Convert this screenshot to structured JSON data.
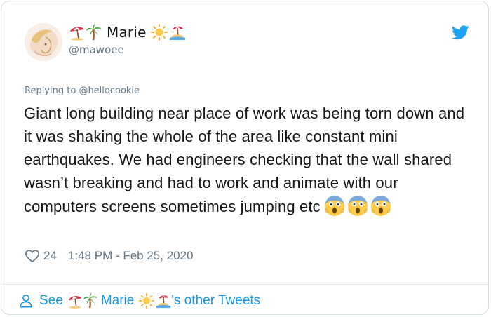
{
  "user": {
    "display_name": "Marie",
    "handle": "@mawoee",
    "name_emojis_before": [
      "umbrella-on-ground-icon",
      "palm-tree-icon"
    ],
    "name_emojis_after": [
      "sun-icon",
      "desert-island-icon"
    ]
  },
  "tweet": {
    "replying_prefix": "Replying to",
    "replying_to": "@hellocookie",
    "text": "Giant long building near place of work was being torn down and it was shaking the whole of the area like constant mini earthquakes. We had engineers checking that the wall shared wasn’t breaking and had to work and animate with our computers screens sometimes jumping etc",
    "trailing_emojis": [
      "face-screaming-in-fear-icon",
      "face-screaming-in-fear-icon",
      "face-screaming-in-fear-icon"
    ],
    "likes": "24",
    "timestamp": "1:48 PM - Feb 25, 2020"
  },
  "footer": {
    "prefix": "See",
    "name": "Marie",
    "suffix": "'s other Tweets"
  },
  "colors": {
    "text": "#14171a",
    "secondary": "#657786",
    "link": "#1b95e0",
    "twitter_blue": "#1da1f2",
    "border": "#e1e8ed"
  }
}
